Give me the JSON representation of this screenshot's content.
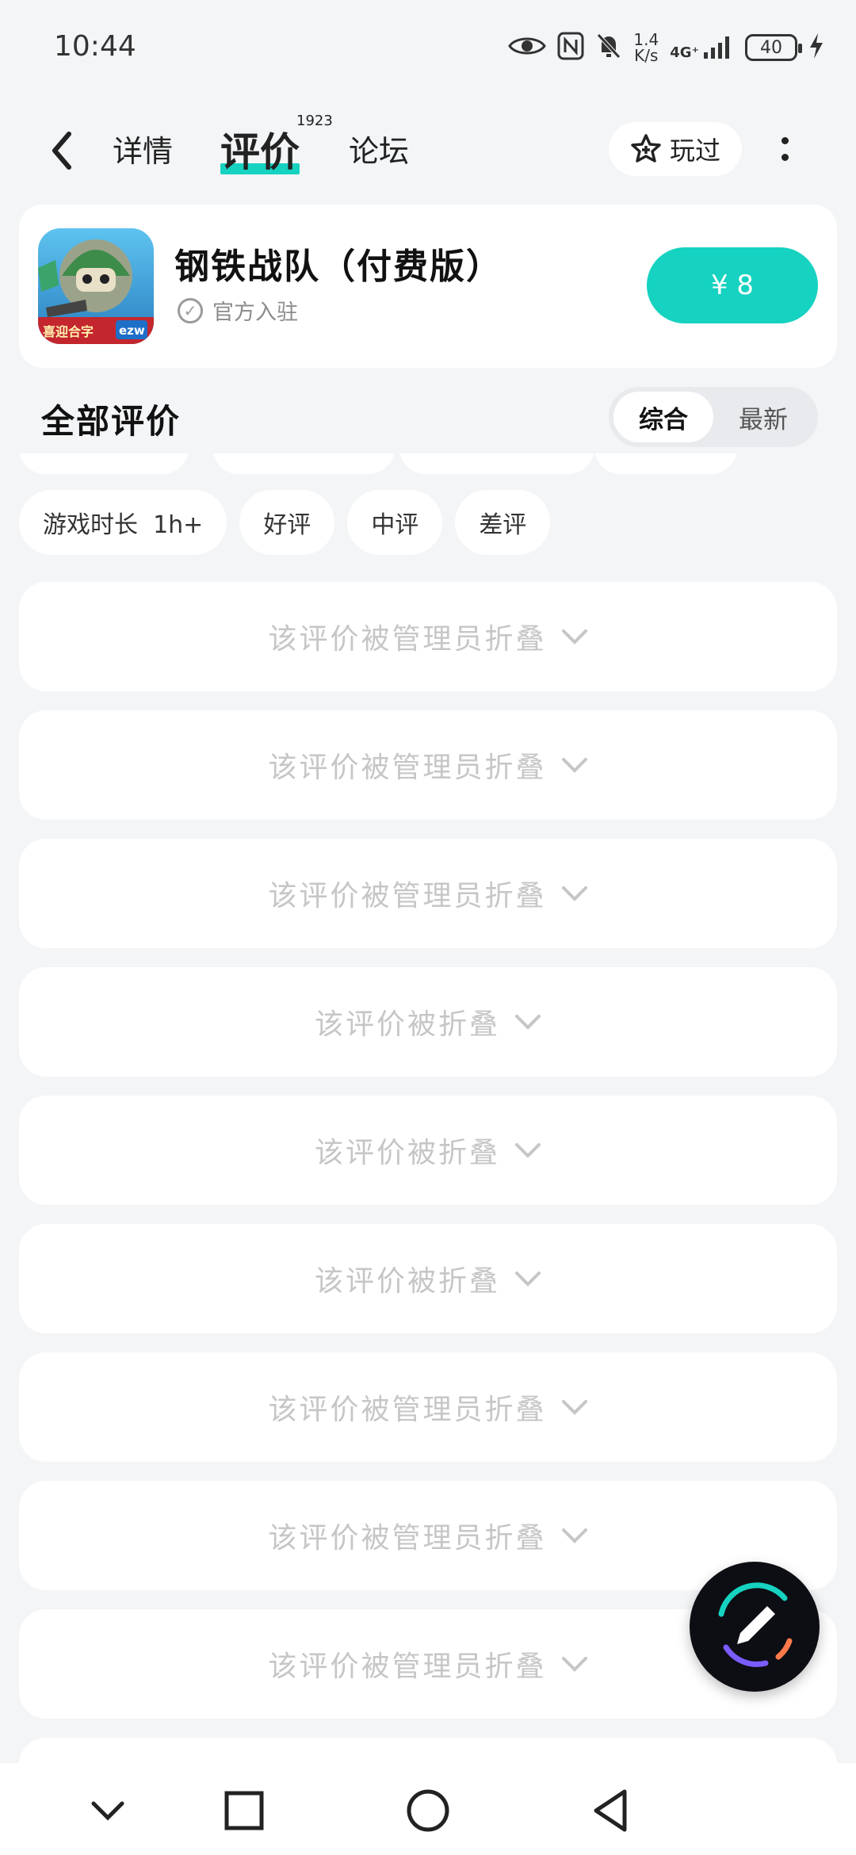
{
  "status_bar": {
    "time": "10:44",
    "net_speed_value": "1.4",
    "net_speed_unit": "K/s",
    "signal_label": "4G⁺",
    "battery": "40"
  },
  "nav": {
    "tab_details": "详情",
    "tab_reviews": "评价",
    "reviews_count": "1923",
    "tab_forum": "论坛",
    "played_label": "玩过"
  },
  "game": {
    "title": "钢铁战队（付费版）",
    "official_label": "官方入驻",
    "price": "¥ 8",
    "accent_color": "#16d2c0"
  },
  "reviews": {
    "title": "全部评价",
    "sort_options": [
      "综合",
      "最新"
    ],
    "active_sort": "综合",
    "filters": [
      "游戏时长  1h+",
      "好评",
      "中评",
      "差评"
    ],
    "folded_items": [
      "该评价被管理员折叠",
      "该评价被管理员折叠",
      "该评价被管理员折叠",
      "该评价被折叠",
      "该评价被折叠",
      "该评价被折叠",
      "该评价被管理员折叠",
      "该评价被管理员折叠",
      "该评价被管理员折叠"
    ]
  },
  "icons": {
    "back": "chevron-left-icon",
    "played": "star-plus-icon",
    "more": "more-vertical-icon",
    "fold": "chevron-down-icon",
    "fab": "pencil-icon"
  }
}
